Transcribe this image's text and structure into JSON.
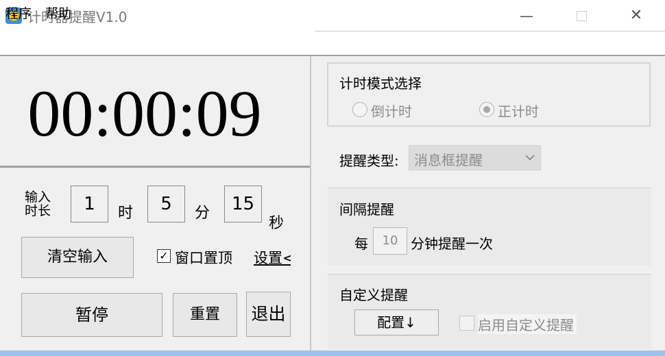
{
  "window": {
    "title": "计时器提醒V1.0",
    "minimize_glyph": "—",
    "close_glyph": "✕"
  },
  "menu": {
    "items": [
      {
        "label": "程序"
      },
      {
        "label": "帮助"
      }
    ]
  },
  "timer": {
    "display": "00:00:09"
  },
  "input": {
    "label": "输入时长",
    "hours": "1",
    "minutes": "5",
    "seconds": "15",
    "unit_hour": "时",
    "unit_minute": "分",
    "unit_second": "秒"
  },
  "buttons": {
    "clear_input": "清空输入",
    "pause": "暂停",
    "reset": "重置",
    "exit": "退出",
    "configure": "配置↓"
  },
  "always_on_top": {
    "label": "窗口置顶",
    "checked": true,
    "check_glyph": "✓"
  },
  "settings_link": "设置<",
  "mode": {
    "title": "计时模式选择",
    "options": [
      {
        "label": "倒计时",
        "selected": false
      },
      {
        "label": "正计时",
        "selected": true
      }
    ]
  },
  "reminder_type": {
    "label": "提醒类型:",
    "selected": "消息框提醒"
  },
  "interval": {
    "title": "间隔提醒",
    "prefix": "每",
    "minutes": "10",
    "suffix": "分钟提醒一次"
  },
  "custom": {
    "title": "自定义提醒",
    "enable_label": "启用自定义提醒",
    "enabled": false
  },
  "colors": {
    "window_bg": "#f0f0f0",
    "disabled_text": "#8c8c8c",
    "taskbar_accent": "#9ec1ec"
  }
}
